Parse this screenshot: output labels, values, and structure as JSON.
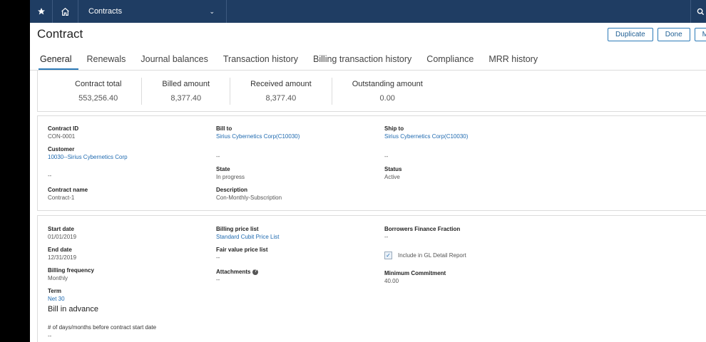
{
  "topbar": {
    "menu_label": "Contracts"
  },
  "header": {
    "title": "Contract",
    "actions": {
      "duplicate": "Duplicate",
      "done": "Done",
      "more": "M"
    }
  },
  "tabs": [
    {
      "label": "General",
      "active": true
    },
    {
      "label": "Renewals"
    },
    {
      "label": "Journal balances"
    },
    {
      "label": "Transaction history"
    },
    {
      "label": "Billing transaction history"
    },
    {
      "label": "Compliance"
    },
    {
      "label": "MRR history"
    }
  ],
  "totals": [
    {
      "label": "Contract total",
      "value": "553,256.40"
    },
    {
      "label": "Billed amount",
      "value": "8,377.40"
    },
    {
      "label": "Received amount",
      "value": "8,377.40"
    },
    {
      "label": "Outstanding amount",
      "value": "0.00"
    }
  ],
  "details": {
    "contract_id_label": "Contract ID",
    "contract_id": "CON-0001",
    "customer_label": "Customer",
    "customer": "10030--Sirius Cybernetics Corp",
    "customer_sub": "--",
    "contract_name_label": "Contract name",
    "contract_name": "Contract-1",
    "bill_to_label": "Bill to",
    "bill_to": "Sirius Cybernetics Corp(C10030)",
    "bill_to_sub": "--",
    "state_label": "State",
    "state": "In progress",
    "description_label": "Description",
    "description": "Con-Monthly-Subscription",
    "ship_to_label": "Ship to",
    "ship_to": "Sirius Cybernetics Corp(C10030)",
    "ship_to_sub": "--",
    "status_label": "Status",
    "status": "Active"
  },
  "terms": {
    "start_date_label": "Start date",
    "start_date": "01/01/2019",
    "end_date_label": "End date",
    "end_date": "12/31/2019",
    "billing_frequency_label": "Billing frequency",
    "billing_frequency": "Monthly",
    "term_label": "Term",
    "term": "Net 30",
    "bill_in_advance": "Bill in advance",
    "days_before_label": "# of days/months before contract start date",
    "days_before": "--",
    "billing_price_list_label": "Billing price list",
    "billing_price_list": "Standard Cubit Price List",
    "fair_value_label": "Fair value price list",
    "fair_value": "--",
    "attachments_label": "Attachments",
    "attachments": "--",
    "borrowers_label": "Borrowers Finance Fraction",
    "borrowers": "--",
    "include_gl_label": "Include in GL Detail Report",
    "include_gl_checked": true,
    "min_commitment_label": "Minimum Commitment",
    "min_commitment": "40.00"
  }
}
